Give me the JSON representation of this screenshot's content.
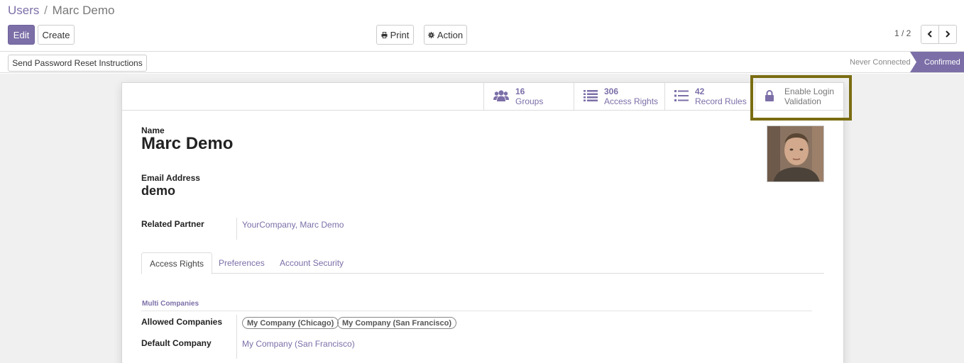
{
  "breadcrumb": {
    "parent": "Users",
    "separator": "/",
    "current": "Marc Demo"
  },
  "toolbar": {
    "edit_label": "Edit",
    "create_label": "Create",
    "print_label": "Print",
    "action_label": "Action"
  },
  "pager": {
    "text": "1 / 2"
  },
  "statusbar": {
    "reset_label": "Send Password Reset Instructions",
    "stages": [
      "Never Connected",
      "Confirmed"
    ],
    "active_stage": "Confirmed"
  },
  "stat_buttons": {
    "groups": {
      "value": "16",
      "label": "Groups"
    },
    "access_rights": {
      "value": "306",
      "label": "Access Rights"
    },
    "record_rules": {
      "value": "42",
      "label": "Record Rules"
    },
    "login_validation": {
      "line1": "Enable Login",
      "line2": "Validation"
    }
  },
  "form": {
    "name_label": "Name",
    "name_value": "Marc Demo",
    "email_label": "Email Address",
    "email_value": "demo",
    "partner_label": "Related Partner",
    "partner_value": "YourCompany, Marc Demo"
  },
  "tabs": [
    "Access Rights",
    "Preferences",
    "Account Security"
  ],
  "active_tab": "Access Rights",
  "multi_companies": {
    "title": "Multi Companies",
    "allowed_label": "Allowed Companies",
    "allowed_tags": [
      "My Company (Chicago)",
      "My Company (San Francisco)"
    ],
    "default_label": "Default Company",
    "default_value": "My Company (San Francisco)"
  },
  "colors": {
    "brand": "#7c6fa8",
    "highlight": "#7a6d12"
  },
  "icons": [
    "print-icon",
    "gear-icon",
    "chevron-left-icon",
    "chevron-right-icon",
    "users-icon",
    "list-icon",
    "lock-icon"
  ]
}
